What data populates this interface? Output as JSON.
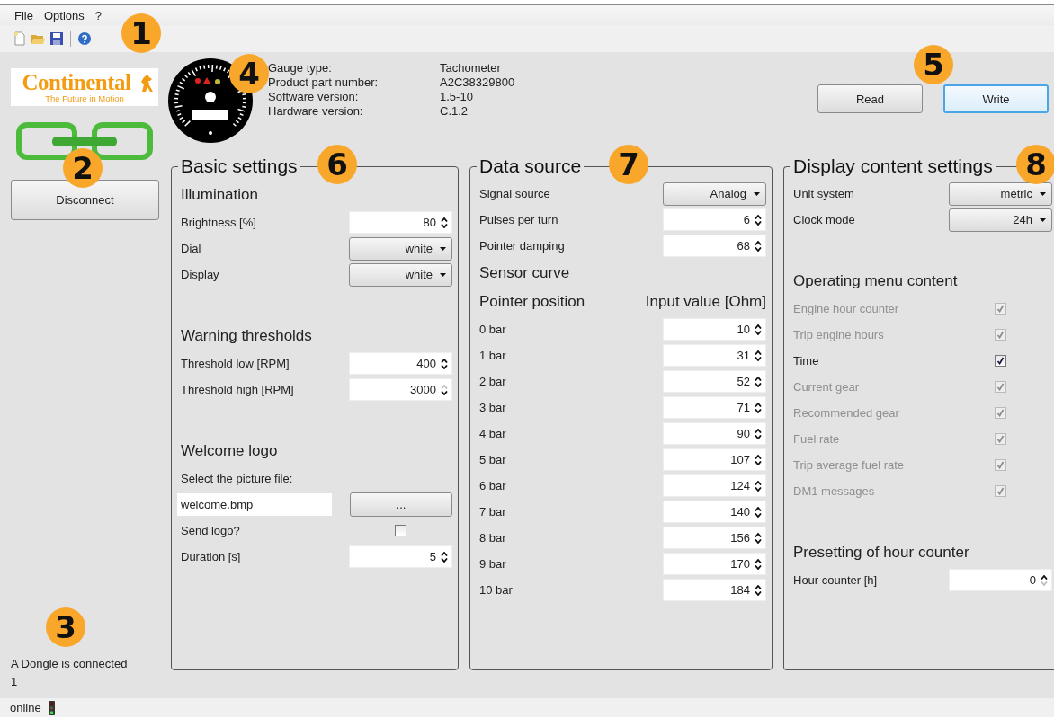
{
  "menu": [
    {
      "label": "File"
    },
    {
      "label": "Options"
    },
    {
      "label": "?"
    }
  ],
  "logo": {
    "name": "Continental",
    "tagline": "The Future in Motion"
  },
  "device_info": [
    {
      "label": "Gauge type:",
      "value": "Tachometer"
    },
    {
      "label": "Product part number:",
      "value": "A2C38329800"
    },
    {
      "label": "Software version:",
      "value": "1.5-10"
    },
    {
      "label": "Hardware version:",
      "value": "C.1.2"
    }
  ],
  "actions": [
    {
      "label": "Read",
      "focused": false
    },
    {
      "label": "Write",
      "focused": true
    }
  ],
  "connection": {
    "button": "Disconnect",
    "status": "A Dongle is connected",
    "count": "1"
  },
  "panels": [
    {
      "title": "Basic settings",
      "sections": [
        [
          {
            "kind": "heading",
            "label": "Illumination"
          },
          {
            "kind": "spin",
            "label": "Brightness [%]",
            "value": "80",
            "up_disabled": false,
            "down_disabled": false
          },
          {
            "kind": "dropdown",
            "label": "Dial",
            "value": "white"
          },
          {
            "kind": "dropdown",
            "label": "Display",
            "value": "white"
          }
        ],
        [
          {
            "kind": "heading",
            "label": "Warning thresholds"
          },
          {
            "kind": "spin",
            "label": "Threshold low [RPM]",
            "value": "400",
            "up_disabled": false,
            "down_disabled": false
          },
          {
            "kind": "spin",
            "label": "Threshold high [RPM]",
            "value": "3000",
            "up_disabled": true,
            "down_disabled": false
          }
        ],
        [
          {
            "kind": "heading",
            "label": "Welcome logo"
          },
          {
            "kind": "label",
            "label": "Select the picture file:"
          },
          {
            "kind": "file",
            "value": "welcome.bmp",
            "button": "..."
          },
          {
            "kind": "checkbox",
            "label": "Send logo?",
            "checked": false,
            "disabled": false
          },
          {
            "kind": "spin",
            "label": "Duration [s]",
            "value": "5",
            "up_disabled": false,
            "down_disabled": false
          }
        ]
      ]
    },
    {
      "title": "Data source",
      "sections": [
        [
          {
            "kind": "dropdown",
            "label": "Signal source",
            "value": "Analog"
          },
          {
            "kind": "spin",
            "label": "Pulses per turn",
            "value": "6",
            "up_disabled": false,
            "down_disabled": false
          },
          {
            "kind": "spin",
            "label": "Pointer damping",
            "value": "68",
            "up_disabled": false,
            "down_disabled": false
          },
          {
            "kind": "heading",
            "label": "Sensor curve"
          },
          {
            "kind": "columns",
            "label": "Pointer position",
            "value": "Input value [Ohm]"
          },
          {
            "kind": "spin",
            "label": "0 bar",
            "value": "10",
            "up_disabled": false,
            "down_disabled": false
          },
          {
            "kind": "spin",
            "label": "1 bar",
            "value": "31",
            "up_disabled": false,
            "down_disabled": false
          },
          {
            "kind": "spin",
            "label": "2 bar",
            "value": "52",
            "up_disabled": false,
            "down_disabled": false
          },
          {
            "kind": "spin",
            "label": "3 bar",
            "value": "71",
            "up_disabled": false,
            "down_disabled": false
          },
          {
            "kind": "spin",
            "label": "4 bar",
            "value": "90",
            "up_disabled": false,
            "down_disabled": false
          },
          {
            "kind": "spin",
            "label": "5 bar",
            "value": "107",
            "up_disabled": false,
            "down_disabled": false
          },
          {
            "kind": "spin",
            "label": "6 bar",
            "value": "124",
            "up_disabled": false,
            "down_disabled": false
          },
          {
            "kind": "spin",
            "label": "7 bar",
            "value": "140",
            "up_disabled": false,
            "down_disabled": false
          },
          {
            "kind": "spin",
            "label": "8 bar",
            "value": "156",
            "up_disabled": false,
            "down_disabled": false
          },
          {
            "kind": "spin",
            "label": "9 bar",
            "value": "170",
            "up_disabled": false,
            "down_disabled": false
          },
          {
            "kind": "spin",
            "label": "10 bar",
            "value": "184",
            "up_disabled": false,
            "down_disabled": false
          }
        ]
      ]
    },
    {
      "title": "Display content settings",
      "sections": [
        [
          {
            "kind": "dropdown",
            "label": "Unit system",
            "value": "metric"
          },
          {
            "kind": "dropdown",
            "label": "Clock mode",
            "value": "24h"
          }
        ],
        [
          {
            "kind": "heading",
            "label": "Operating menu content"
          },
          {
            "kind": "checkbox",
            "label": "Engine hour counter",
            "checked": true,
            "disabled": true
          },
          {
            "kind": "checkbox",
            "label": "Trip engine hours",
            "checked": true,
            "disabled": true
          },
          {
            "kind": "checkbox",
            "label": "Time",
            "checked": true,
            "disabled": false
          },
          {
            "kind": "checkbox",
            "label": "Current gear",
            "checked": true,
            "disabled": true
          },
          {
            "kind": "checkbox",
            "label": "Recommended gear",
            "checked": true,
            "disabled": true
          },
          {
            "kind": "checkbox",
            "label": "Fuel rate",
            "checked": true,
            "disabled": true
          },
          {
            "kind": "checkbox",
            "label": "Trip average fuel rate",
            "checked": true,
            "disabled": true
          },
          {
            "kind": "checkbox",
            "label": "DM1 messages",
            "checked": true,
            "disabled": true
          }
        ],
        [
          {
            "kind": "heading",
            "label": "Presetting of hour counter"
          },
          {
            "kind": "spin",
            "label": "Hour counter [h]",
            "value": "0",
            "up_disabled": false,
            "down_disabled": true
          }
        ]
      ]
    }
  ],
  "status_bar": {
    "text": "online"
  },
  "callouts": [
    {
      "number": "1"
    },
    {
      "number": "2"
    },
    {
      "number": "3"
    },
    {
      "number": "4"
    },
    {
      "number": "5"
    },
    {
      "number": "6"
    },
    {
      "number": "7"
    },
    {
      "number": "8"
    }
  ]
}
